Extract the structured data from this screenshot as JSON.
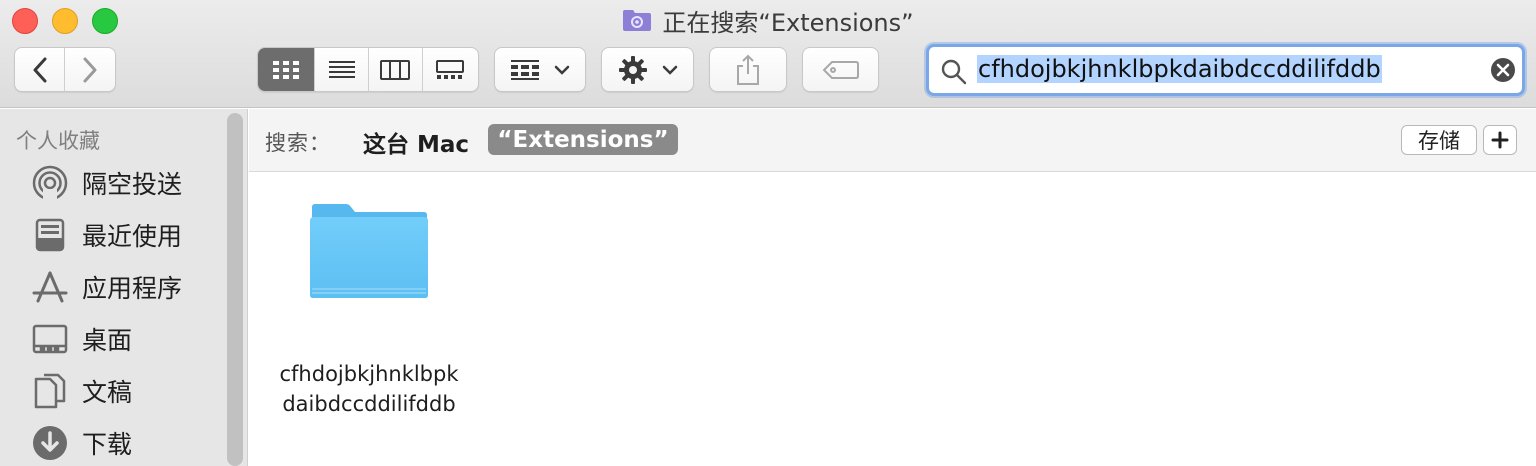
{
  "window": {
    "title": "正在搜索“Extensions”"
  },
  "toolbar": {
    "back_icon": "chevron-left-icon",
    "forward_icon": "chevron-right-icon",
    "view_modes": [
      "icon-view-icon",
      "list-view-icon",
      "column-view-icon",
      "gallery-view-icon"
    ],
    "active_view": "icon-view-icon",
    "group_icon": "group-by-icon",
    "action_icon": "gear-icon",
    "share_icon": "share-icon",
    "tag_icon": "tag-icon"
  },
  "search": {
    "query": "cfhdojbkjhnklbpkdaibdccddilifddb",
    "search_icon": "magnifier-icon",
    "clear_icon": "clear-icon"
  },
  "sidebar": {
    "header": "个人收藏",
    "items": [
      {
        "label": "隔空投送",
        "icon": "airdrop-icon"
      },
      {
        "label": "最近使用",
        "icon": "recents-icon"
      },
      {
        "label": "应用程序",
        "icon": "applications-icon"
      },
      {
        "label": "桌面",
        "icon": "desktop-icon"
      },
      {
        "label": "文稿",
        "icon": "documents-icon"
      },
      {
        "label": "下载",
        "icon": "downloads-icon"
      }
    ]
  },
  "scope": {
    "label": "搜索：",
    "this_mac": "这台 Mac",
    "folder": "“Extensions”",
    "save_label": "存储"
  },
  "results": [
    {
      "name_line1": "cfhdojbkjhnklbpk",
      "name_line2": "daibdccddilifddb",
      "icon": "folder-icon"
    }
  ],
  "colors": {
    "accent": "#7aa7e8",
    "selection": "#b3d4ff",
    "folder": "#6ec6f5"
  }
}
